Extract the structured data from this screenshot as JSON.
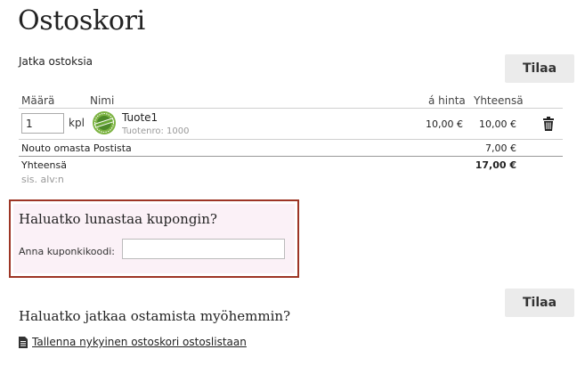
{
  "page": {
    "title": "Ostoskori",
    "continue_link": "Jatka ostoksia"
  },
  "actions": {
    "order_label": "Tilaa"
  },
  "table": {
    "headers": {
      "quantity": "Määrä",
      "name": "Nimi",
      "unit_price": "á hinta",
      "total": "Yhteensä"
    },
    "items": [
      {
        "quantity": "1",
        "unit": "kpl",
        "name": "Tuote1",
        "sku": "Tuotenro: 1000",
        "unit_price": "10,00 €",
        "total": "10,00 €",
        "badge_icon": "product-seal-icon",
        "remove_icon": "trash-icon"
      }
    ],
    "shipping": {
      "label": "Nouto omasta Postista",
      "total": "7,00 €"
    },
    "grand_total": {
      "label": "Yhteensä",
      "vat_note": "sis. alv:n",
      "total": "17,00 €"
    }
  },
  "coupon": {
    "title": "Haluatko lunastaa kupongin?",
    "label": "Anna kuponkikoodi:",
    "value": "",
    "border_color": "#9d3525"
  },
  "save_for_later": {
    "title": "Haluatko jatkaa ostamista myöhemmin?",
    "link": "Tallenna nykyinen ostoskori ostoslistaan",
    "icon": "document-icon"
  }
}
